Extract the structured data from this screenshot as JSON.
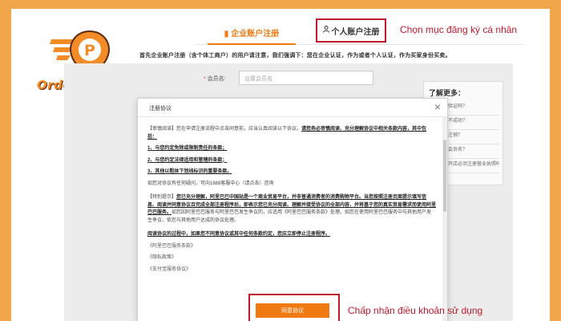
{
  "brand": {
    "name": "Order Plus"
  },
  "tabs": {
    "company": {
      "label": "企业账户注册",
      "icon": "building-icon"
    },
    "personal": {
      "label": "个人账户注册",
      "icon": "user-icon"
    }
  },
  "annotations": {
    "top": "Chọn mục đăng ký cá nhân",
    "bottom": "Chấp nhận điều khoản sử dụng"
  },
  "notice": "首先企业账户注册（含个体工商户）的用户请注意，我们强调下：您在企业认证，作为或者个人认证，作为买家身份买卖。",
  "form": {
    "member_label": "会员名:",
    "member_placeholder": "设置会员名"
  },
  "help": {
    "title": "了解更多：",
    "items": [
      "如何收到验证码？",
      "账户注册不成功？",
      "账户如何注销？",
      "如何设置会员名？",
      "阿里巴巴开店必须注册营业执照吗？"
    ]
  },
  "modal": {
    "title": "注册协议",
    "close": "×",
    "para1_lead": "【审慎阅读】",
    "para1_text": "您在申请注册流程中点击同意前，应当认真阅读以下协议。",
    "para1_emph": "请您务必审慎阅读、充分理解协议中相关条款内容，其中包括：",
    "list": [
      "1、与您约定免除或限制责任的条款；",
      "2、与您约定法律适用和管辖的条款；",
      "3、其他以粗体下划线标识的重要条款。"
    ],
    "contact": "如您对协议有任何疑问，可向1688客服中心（请点击）咨询",
    "para2_lead": "【特别提示】",
    "para2_emph": "您已充分理解，阿里巴巴中国站是一个商业贸易平台，并非普通消费者的消费购物平台。当您按照注册页面提示填写信息、阅读并同意协议且完成全部注册程序后，即表示您已充分阅读、理解并接受协议的全部内容，并将基于您的真实贸易需求而使用阿里巴巴服务。",
    "para2_text": "如您因阿里巴巴服务与阿里巴巴发生争议的，应适用《阿里巴巴服务条款》处理。如您在使用阿里巴巴服务中与其他用户发生争议，依您与其他用户达成的协议处理。",
    "para3_emph": "阅读协议的过程中，如果您不同意协议或其中任何条款约定，您应立即停止注册程序。",
    "links": [
      "《阿里巴巴服务条款》",
      "《隐私政策》",
      "《支付宝服务协议》"
    ],
    "agree_button": "同意协议"
  }
}
